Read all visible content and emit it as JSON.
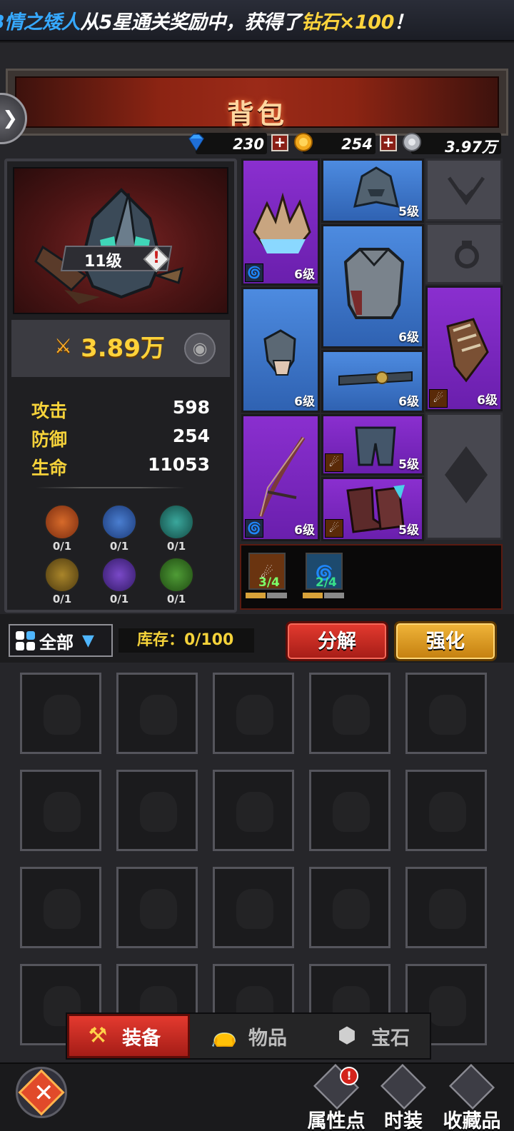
{
  "banner": {
    "player_name": "B情之矮人",
    "middle_text": "从5星通关奖励中，获得了",
    "reward_text": "钻石×100",
    "end_text": "！"
  },
  "title": "背包",
  "currency": {
    "diamond": "230",
    "gold": "254",
    "silver": "3.97万"
  },
  "hero": {
    "power": "3.89万",
    "level": "11级",
    "stats": [
      {
        "label": "攻击",
        "value": "598"
      },
      {
        "label": "防御",
        "value": "254"
      },
      {
        "label": "生命",
        "value": "11053"
      }
    ],
    "elements": [
      {
        "name": "fire",
        "count": "0/1",
        "color": "#b8501f"
      },
      {
        "name": "frost",
        "count": "0/1",
        "color": "#2c59a7"
      },
      {
        "name": "crystal",
        "count": "0/1",
        "color": "#237872"
      },
      {
        "name": "light",
        "count": "0/1",
        "color": "#7a5c1d"
      },
      {
        "name": "shadow",
        "count": "0/1",
        "color": "#5a2e9b"
      },
      {
        "name": "nature",
        "count": "0/1",
        "color": "#3b7a2a"
      }
    ]
  },
  "equipment_slots": [
    {
      "id": "shoulder",
      "rarity": "purple",
      "level": "6级",
      "badge": "swirl"
    },
    {
      "id": "helmet",
      "rarity": "blue",
      "level": "5级",
      "badge": ""
    },
    {
      "id": "amulet",
      "rarity": "empty",
      "level": "",
      "badge": ""
    },
    {
      "id": "chest",
      "rarity": "blue",
      "level": "6级",
      "badge": ""
    },
    {
      "id": "ring",
      "rarity": "empty",
      "level": "",
      "badge": ""
    },
    {
      "id": "gauntlet-left",
      "rarity": "blue",
      "level": "6级",
      "badge": ""
    },
    {
      "id": "bracer",
      "rarity": "purple",
      "level": "6级",
      "badge": "fireball"
    },
    {
      "id": "belt",
      "rarity": "blue",
      "level": "6级",
      "badge": ""
    },
    {
      "id": "bow",
      "rarity": "purple",
      "level": "6级",
      "badge": "swirl"
    },
    {
      "id": "pants",
      "rarity": "purple",
      "level": "5级",
      "badge": "fireball"
    },
    {
      "id": "boots",
      "rarity": "purple",
      "level": "5级",
      "badge": "fireball"
    },
    {
      "id": "relic",
      "rarity": "empty",
      "level": "",
      "badge": ""
    }
  ],
  "sets": [
    {
      "name": "fireball",
      "count": "3/4",
      "filled": 1,
      "color": "#f0a23a"
    },
    {
      "name": "swirl",
      "count": "2/4",
      "filled": 1,
      "color": "#38e08a"
    }
  ],
  "inventory": {
    "filter_label": "全部",
    "stock_text": "库存：0/100",
    "decompose_label": "分解",
    "enhance_label": "强化"
  },
  "tabs": [
    {
      "label": "装备",
      "icon": "hammer-icon",
      "active": true
    },
    {
      "label": "物品",
      "icon": "bag-icon",
      "active": false
    },
    {
      "label": "宝石",
      "icon": "gem-icon",
      "active": false
    }
  ],
  "footer": {
    "attributes_label": "属性点",
    "costume_label": "时装",
    "collection_label": "收藏品",
    "attributes_notification": "!"
  }
}
